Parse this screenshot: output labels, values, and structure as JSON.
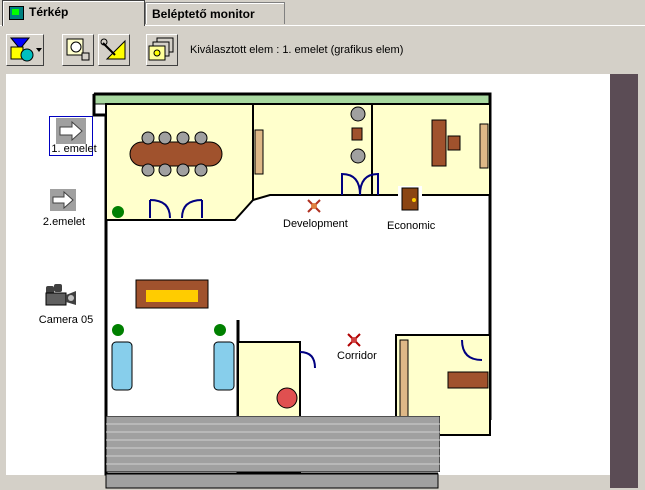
{
  "tabs": [
    {
      "label": "Térkép",
      "active": true
    },
    {
      "label": "Beléptető monitor",
      "active": false
    }
  ],
  "toolbar": {
    "selected_label": "Kiválasztott elem : 1. emelet (grafikus elem)"
  },
  "sidebar": {
    "items": [
      {
        "label": "1. emelet",
        "icon": "arrow-right-icon",
        "selected": true
      },
      {
        "label": "2.emelet",
        "icon": "arrow-right-icon",
        "selected": false
      },
      {
        "label": "Camera 05",
        "icon": "camera-icon",
        "selected": false
      }
    ]
  },
  "map": {
    "markers": [
      {
        "label": "Development",
        "icon": "sensor-alarm-icon"
      },
      {
        "label": "Economic",
        "icon": "door-icon"
      },
      {
        "label": "Corridor",
        "icon": "sensor-alarm-icon"
      }
    ]
  }
}
